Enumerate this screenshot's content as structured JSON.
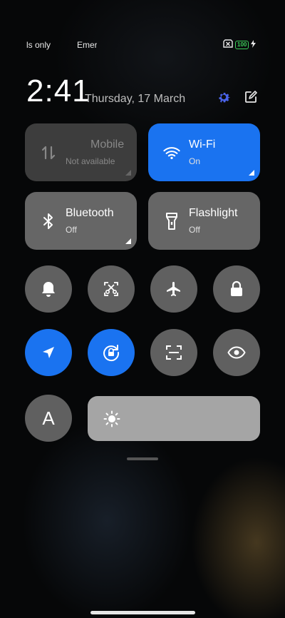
{
  "status_bar": {
    "left_text": "ls only",
    "mid_text": "Emer",
    "battery_level": "100",
    "icons": [
      "sim-off-icon",
      "battery-icon",
      "charging-bolt-icon"
    ]
  },
  "header": {
    "time": "2:41",
    "date": "Thursday, 17 March",
    "settings_icon": "gear-icon",
    "edit_icon": "edit-icon",
    "accent": "#4a63e8"
  },
  "tiles": [
    {
      "id": "mobile-data",
      "title": "Mobile",
      "subtitle": "Not available",
      "state": "disabled",
      "icon": "mobile-data-icon"
    },
    {
      "id": "wifi",
      "title": "Wi-Fi",
      "subtitle": "On",
      "state": "on",
      "icon": "wifi-icon"
    },
    {
      "id": "bluetooth",
      "title": "Bluetooth",
      "subtitle": "Off",
      "state": "off",
      "icon": "bluetooth-icon"
    },
    {
      "id": "flashlight",
      "title": "Flashlight",
      "subtitle": "Off",
      "state": "off",
      "icon": "flashlight-icon"
    }
  ],
  "toggles": [
    {
      "id": "sound",
      "icon": "bell-icon",
      "on": false
    },
    {
      "id": "screenshot",
      "icon": "scissors-screenshot-icon",
      "on": false
    },
    {
      "id": "airplane-mode",
      "icon": "airplane-icon",
      "on": false
    },
    {
      "id": "lock-screen",
      "icon": "lock-icon",
      "on": false
    },
    {
      "id": "location",
      "icon": "location-arrow-icon",
      "on": true
    },
    {
      "id": "rotation-lock",
      "icon": "rotation-lock-icon",
      "on": true
    },
    {
      "id": "scanner",
      "icon": "scan-icon",
      "on": false
    },
    {
      "id": "reading-mode",
      "icon": "eye-icon",
      "on": false
    }
  ],
  "auto_brightness_label": "A",
  "brightness": {
    "level": 1.0,
    "icon": "sun-icon"
  },
  "colors": {
    "active": "#1a73f0",
    "inactive": "#606060",
    "battery": "#3ccf5a"
  }
}
